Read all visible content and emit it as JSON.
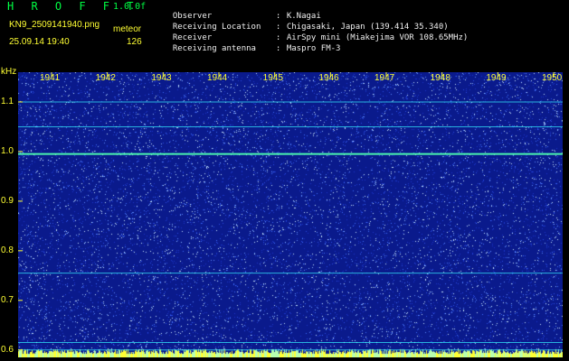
{
  "header": {
    "app_title": "H R O F F T",
    "version": "1.0.0f",
    "filename": "KN9_2509141940.png",
    "mode": "meteor",
    "timestamp": "25.09.14 19:40",
    "count": "126"
  },
  "station_info": [
    {
      "key": "Observer",
      "sep": ":",
      "value": "K.Nagai"
    },
    {
      "key": "Receiving Location",
      "sep": ":",
      "value": "Chigasaki, Japan (139.414 35.340)"
    },
    {
      "key": "Receiver",
      "sep": ":",
      "value": "AirSpy mini (Miakejima VOR 108.65MHz)"
    },
    {
      "key": "Receiving antenna",
      "sep": ":",
      "value": "Maspro FM-3"
    }
  ],
  "spectrogram": {
    "y_unit": "kHz",
    "y_ticks": [
      "1.1",
      "1.0",
      "0.9",
      "0.8",
      "0.7",
      "0.6"
    ],
    "y_range": [
      0.585,
      1.16
    ],
    "x_ticks": [
      "1941",
      "1942",
      "1943",
      "1944",
      "1945",
      "1946",
      "1947",
      "1948",
      "1949",
      "1950"
    ],
    "carrier_lines_khz": [
      1.1,
      1.05,
      0.995,
      0.755,
      0.615,
      0.6
    ],
    "colors": {
      "background": "#0a1a8c",
      "noise": "#3f6cff",
      "carrier": "#36f2ff",
      "strong_carrier": "#4dffb0",
      "label": "#ffff33",
      "header_green": "#00ff44"
    }
  }
}
